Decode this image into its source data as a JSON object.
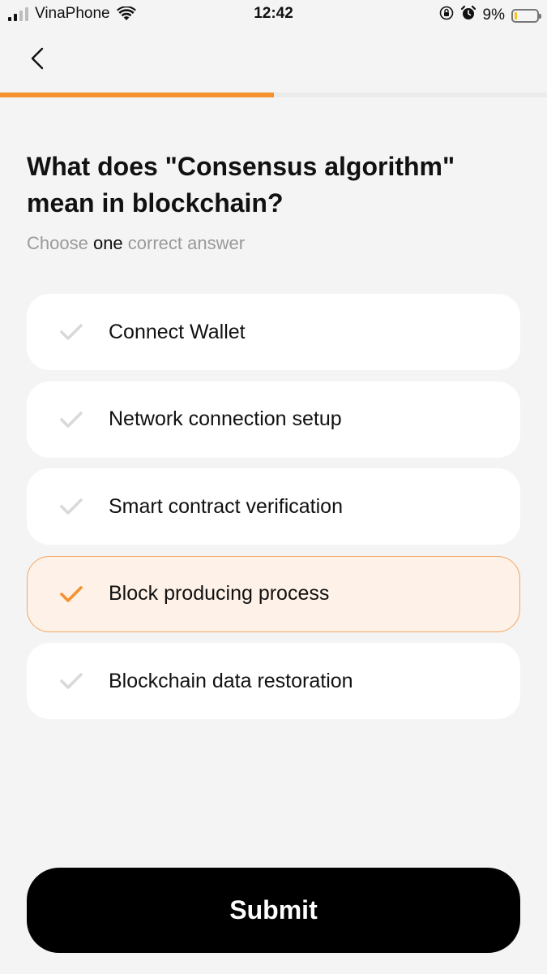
{
  "status_bar": {
    "carrier": "VinaPhone",
    "time": "12:42",
    "battery": "9%"
  },
  "progress": {
    "fraction": 0.5
  },
  "question": {
    "title": "What does \"Consensus algorithm\" mean in blockchain?",
    "instruction_prefix": "Choose ",
    "instruction_emphasis": "one",
    "instruction_suffix": " correct answer"
  },
  "options": [
    {
      "label": "Connect Wallet",
      "selected": false
    },
    {
      "label": "Network connection setup",
      "selected": false
    },
    {
      "label": "Smart contract verification",
      "selected": false
    },
    {
      "label": "Block producing process",
      "selected": true
    },
    {
      "label": "Blockchain data restoration",
      "selected": false
    }
  ],
  "submit_label": "Submit",
  "colors": {
    "accent": "#f6922d",
    "check_inactive": "#d9d9d9",
    "selected_bg": "#fef2e8",
    "selected_border": "#f5a661"
  }
}
